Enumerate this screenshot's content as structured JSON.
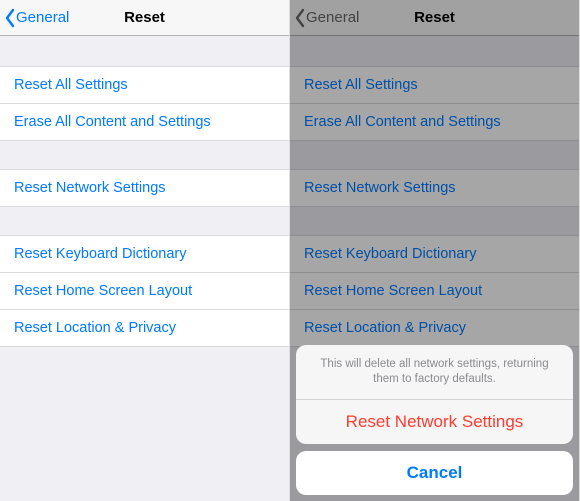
{
  "nav": {
    "back_label": "General",
    "title": "Reset"
  },
  "groups": [
    {
      "items": [
        {
          "label": "Reset All Settings"
        },
        {
          "label": "Erase All Content and Settings"
        }
      ]
    },
    {
      "items": [
        {
          "label": "Reset Network Settings"
        }
      ]
    },
    {
      "items": [
        {
          "label": "Reset Keyboard Dictionary"
        },
        {
          "label": "Reset Home Screen Layout"
        },
        {
          "label": "Reset Location & Privacy"
        }
      ]
    }
  ],
  "sheet": {
    "message": "This will delete all network settings, returning them to factory defaults.",
    "destructive_label": "Reset Network Settings",
    "cancel_label": "Cancel"
  }
}
